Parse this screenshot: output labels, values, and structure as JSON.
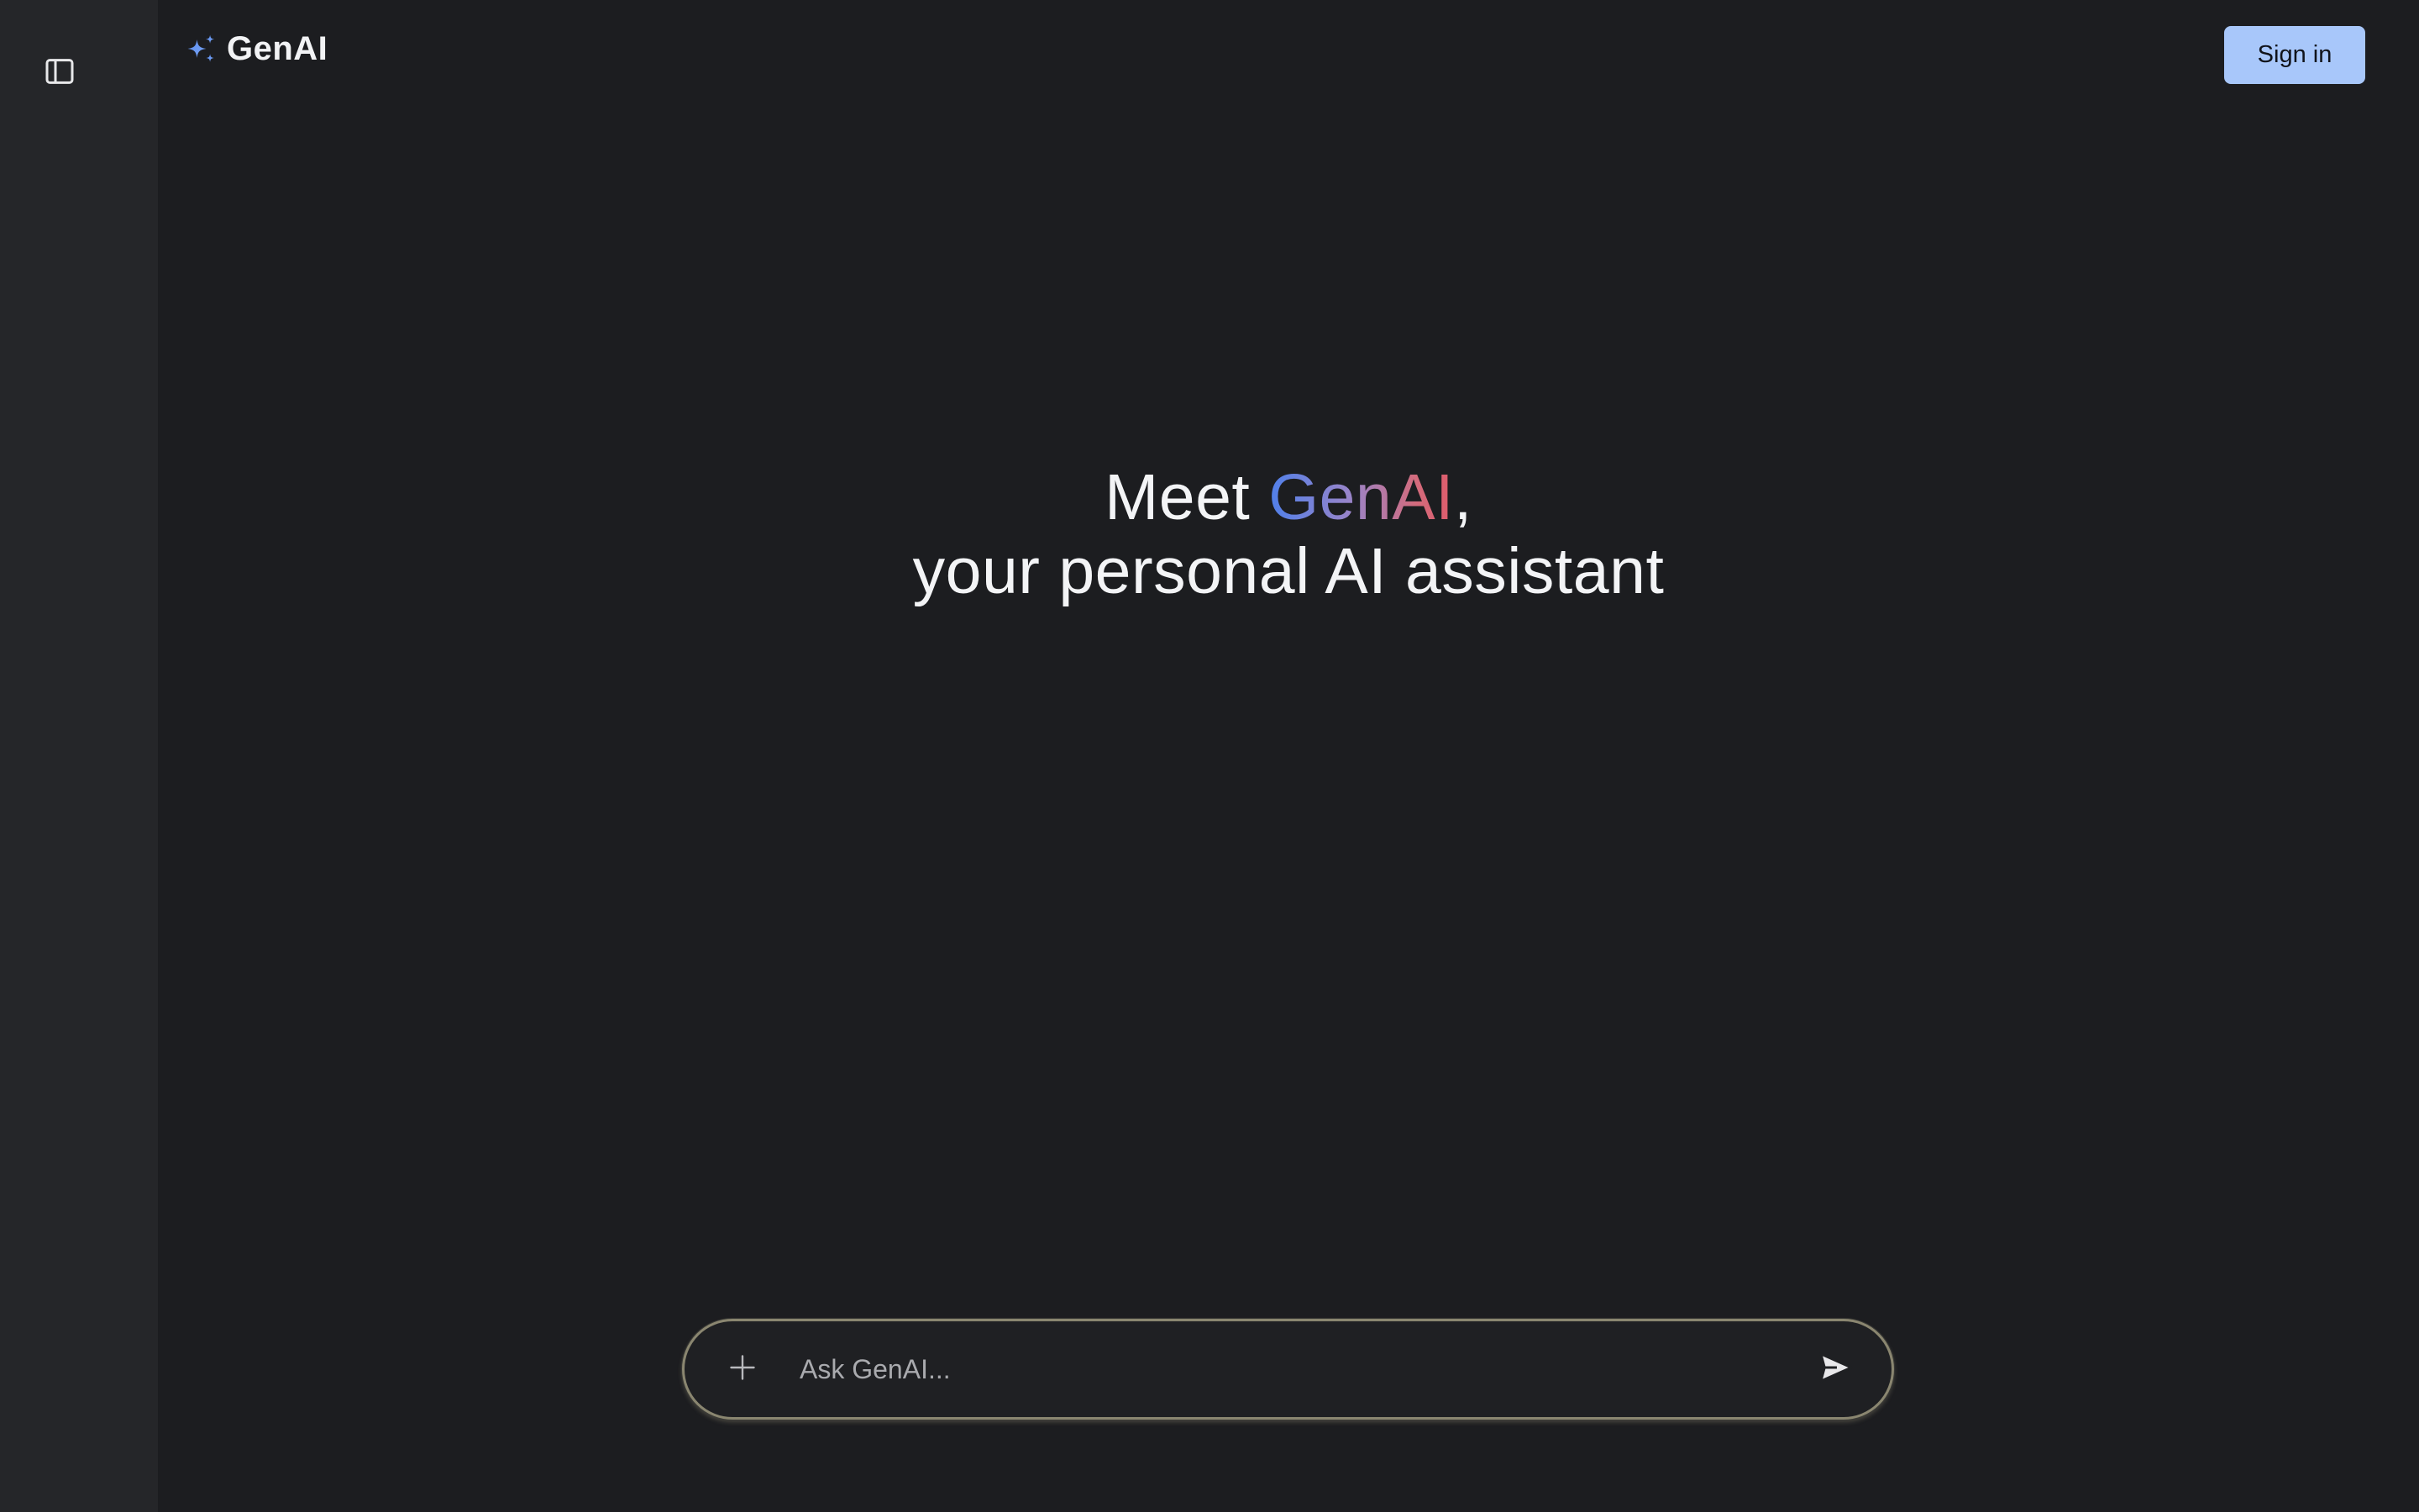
{
  "sidebar": {
    "toggle_icon": "sidebar-panel-icon"
  },
  "header": {
    "brand_icon": "sparkle-icon",
    "brand_name": "GenAI",
    "sign_in_label": "Sign in"
  },
  "hero": {
    "line1_prefix": "Meet ",
    "line1_brand": "GenAI",
    "line1_suffix": ",",
    "line2": "your personal AI assistant"
  },
  "prompt": {
    "add_icon": "plus-icon",
    "placeholder": "Ask GenAI...",
    "value": "",
    "send_icon": "send-icon"
  },
  "colors": {
    "background": "#1c1d20",
    "sidebar": "#252629",
    "sign_in_button": "#a8c7fa",
    "brand_gradient_start": "#4f80ea",
    "brand_gradient_end": "#de5b6b",
    "prompt_border": "#8a8670"
  }
}
